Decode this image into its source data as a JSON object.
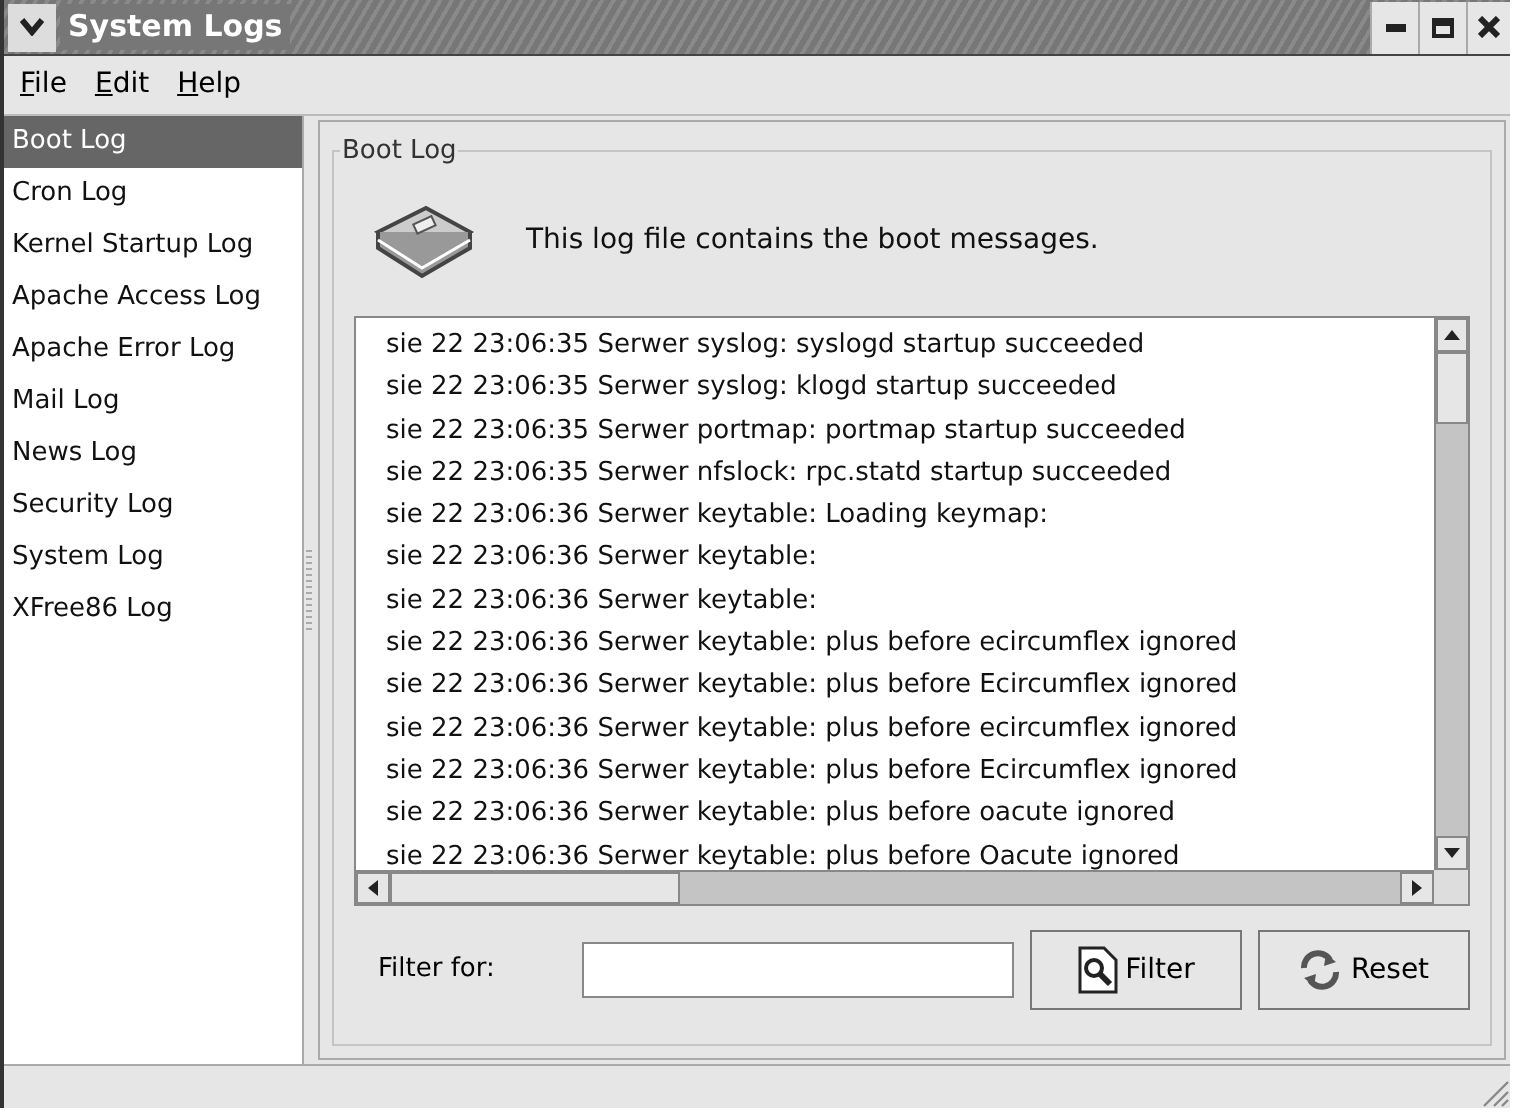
{
  "window": {
    "title": "System Logs"
  },
  "menu": [
    "File",
    "Edit",
    "Help"
  ],
  "sidebar": {
    "items": [
      {
        "label": "Boot Log",
        "selected": true
      },
      {
        "label": "Cron Log",
        "selected": false
      },
      {
        "label": "Kernel Startup Log",
        "selected": false
      },
      {
        "label": "Apache Access Log",
        "selected": false
      },
      {
        "label": "Apache Error Log",
        "selected": false
      },
      {
        "label": "Mail Log",
        "selected": false
      },
      {
        "label": "News Log",
        "selected": false
      },
      {
        "label": "Security Log",
        "selected": false
      },
      {
        "label": "System Log",
        "selected": false
      },
      {
        "label": "XFree86 Log",
        "selected": false
      }
    ]
  },
  "panel": {
    "title": "Boot Log",
    "description": "This log file contains the boot messages.",
    "lines": [
      "sie 22 23:06:35 Serwer syslog: syslogd startup succeeded",
      "sie 22 23:06:35 Serwer syslog: klogd startup succeeded",
      "sie 22 23:06:35 Serwer portmap: portmap startup succeeded",
      "sie 22 23:06:35 Serwer nfslock: rpc.statd startup succeeded",
      "sie 22 23:06:36 Serwer keytable: Loading keymap:",
      "sie 22 23:06:36 Serwer keytable:",
      "sie 22 23:06:36 Serwer keytable:",
      "sie 22 23:06:36 Serwer keytable: plus before ecircumflex ignored",
      "sie 22 23:06:36 Serwer keytable: plus before Ecircumflex ignored",
      "sie 22 23:06:36 Serwer keytable: plus before ecircumflex ignored",
      "sie 22 23:06:36 Serwer keytable: plus before Ecircumflex ignored",
      "sie 22 23:06:36 Serwer keytable: plus before oacute ignored",
      "sie 22 23:06:36 Serwer keytable: plus before Oacute ignored"
    ],
    "filter": {
      "label": "Filter for:",
      "buttons": [
        "Filter",
        "Reset"
      ]
    }
  }
}
